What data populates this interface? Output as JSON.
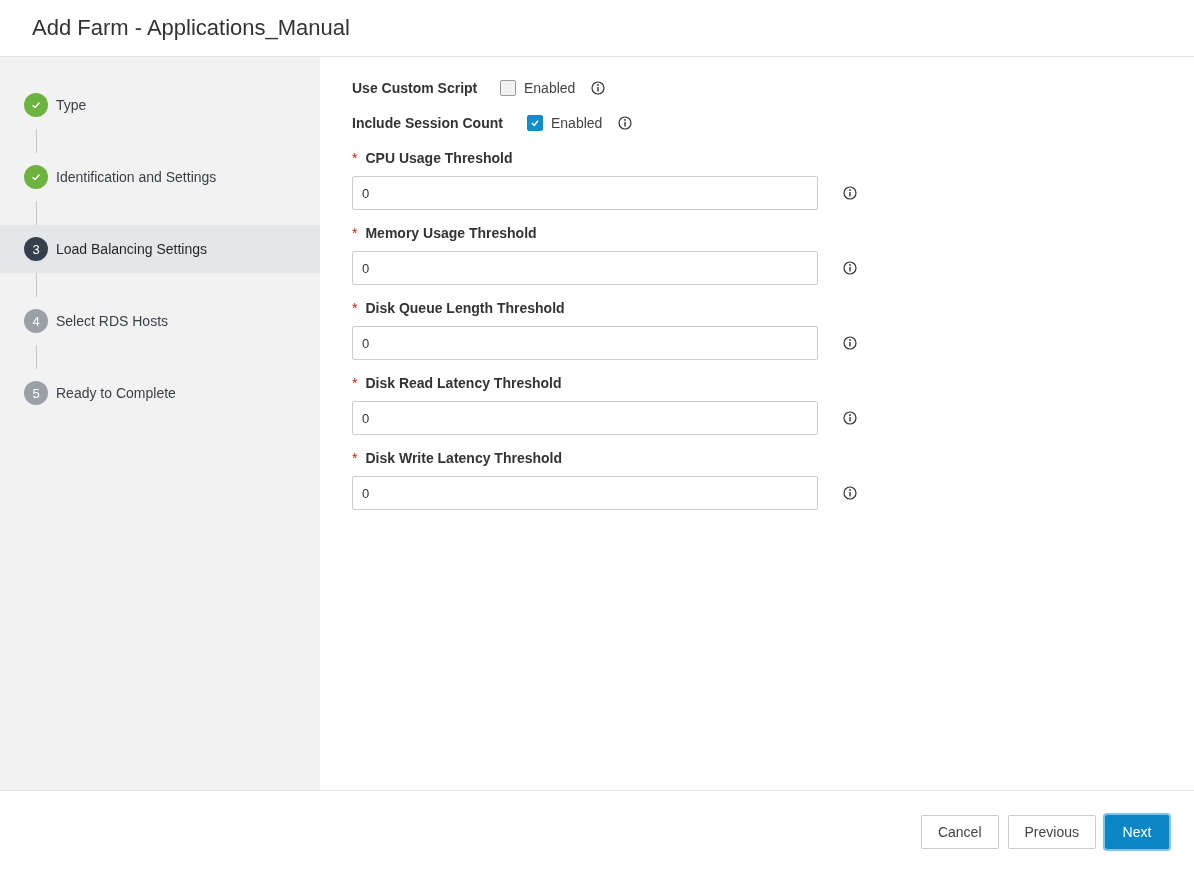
{
  "dialog": {
    "title": "Add Farm - Applications_Manual"
  },
  "steps": [
    {
      "label": "Type",
      "completed": true,
      "selected": false
    },
    {
      "label": "Identification and Settings",
      "completed": true,
      "selected": false
    },
    {
      "label": "Load Balancing Settings",
      "completed": false,
      "number": "3",
      "selected": true
    },
    {
      "label": "Select RDS Hosts",
      "completed": false,
      "number": "4",
      "selected": false
    },
    {
      "label": "Ready to Complete",
      "completed": false,
      "number": "5",
      "selected": false
    }
  ],
  "toggles": [
    {
      "label": "Use Custom Script",
      "option": "Enabled",
      "checked": false
    },
    {
      "label": "Include Session Count",
      "option": "Enabled",
      "checked": true
    }
  ],
  "fields": [
    {
      "label": "CPU Usage Threshold",
      "required_mark": "*",
      "value": "0"
    },
    {
      "label": "Memory Usage Threshold",
      "required_mark": "*",
      "value": "0"
    },
    {
      "label": "Disk Queue Length Threshold",
      "required_mark": "*",
      "value": "0"
    },
    {
      "label": "Disk Read Latency Threshold",
      "required_mark": "*",
      "value": "0"
    },
    {
      "label": "Disk Write Latency Threshold",
      "required_mark": "*",
      "value": "0"
    }
  ],
  "buttons": [
    {
      "label": "Cancel",
      "kind": "secondary"
    },
    {
      "label": "Previous",
      "kind": "secondary"
    },
    {
      "label": "Next",
      "kind": "primary"
    }
  ]
}
